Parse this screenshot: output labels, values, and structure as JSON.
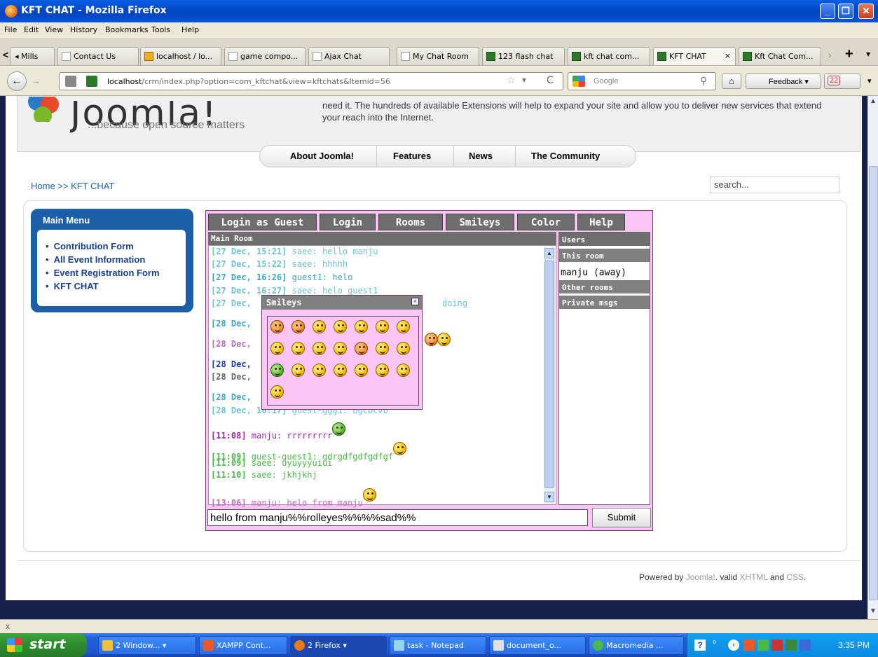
{
  "window": {
    "title": "KFT CHAT - Mozilla Firefox"
  },
  "menubar": [
    "File",
    "Edit",
    "View",
    "History",
    "Bookmarks",
    "Tools",
    "Help"
  ],
  "tabs": [
    {
      "label": "◂ Mills",
      "icon": "page-icon"
    },
    {
      "label": "Contact Us",
      "icon": "page-icon"
    },
    {
      "label": "localhost / lo...",
      "icon": "phpmyadmin-icon"
    },
    {
      "label": "game compo...",
      "icon": "page-icon"
    },
    {
      "label": "Ajax Chat",
      "icon": "page-icon"
    },
    {
      "label": "My Chat Room",
      "icon": "page-icon"
    },
    {
      "label": "123 flash chat",
      "icon": "kft-icon"
    },
    {
      "label": "kft chat com...",
      "icon": "kft-icon"
    },
    {
      "label": "KFT CHAT",
      "icon": "kft-icon"
    },
    {
      "label": "Kft Chat Com...",
      "icon": "kft-icon"
    }
  ],
  "nav": {
    "url_host": "localhost",
    "url_path": "/crm/index.php?option=com_kftchat&view=kftchats&Itemid=56",
    "search_placeholder": "Google",
    "feedback": "Feedback",
    "badge": "22"
  },
  "header": {
    "logo": "Joomla!",
    "tagline": "...because open source matters",
    "text": "need it. The hundreds of available Extensions will help to expand your site and allow you to deliver new services that extend your reach into the Internet."
  },
  "topnav": [
    "About Joomla!",
    "Features",
    "News",
    "The Community"
  ],
  "breadcrumb": "Home >> KFT CHAT",
  "search": "search...",
  "mainmenu": {
    "title": "Main Menu",
    "items": [
      "Contribution Form",
      "All Event Information",
      "Event Registration Form",
      "KFT CHAT"
    ]
  },
  "chat": {
    "buttons": [
      "Login as Guest",
      "Login",
      "Rooms",
      "Smileys",
      "Color",
      "Help"
    ],
    "room_title": "Main Room",
    "messages": [
      {
        "ts": "[27 Dec, 15:21]",
        "text": " saee: hello manju",
        "color": "#6ec3d0"
      },
      {
        "ts": "[27 Dec, 15:22]",
        "text": " saee: hhhhh",
        "color": "#6ec3d0"
      },
      {
        "ts": "[27 Dec, 16:26]",
        "text": " guest1: helo",
        "color": "#3aa6c4"
      },
      {
        "ts": "[27 Dec, 16:27]",
        "text": " saee: helo guest1",
        "color": "#6ec3d0"
      },
      {
        "ts": "[27 Dec,",
        "text": " doing",
        "color": "#6ec3d0"
      },
      {
        "ts": "[28 Dec,",
        "text": "",
        "color": "#3aa6c4"
      },
      {
        "ts": "[28 Dec,",
        "text": "",
        "color": "#c06ac0"
      },
      {
        "ts": "[28 Dec,",
        "text": "",
        "color": "#1a3aa8"
      },
      {
        "ts": "[28 Dec,",
        "text": "",
        "color": "#666666"
      },
      {
        "ts": "[28 Dec,",
        "text": "",
        "color": "#3aa6c4"
      },
      {
        "ts": "[28 Dec, 16:17]",
        "text": " guest-ggg1: bgcbcvb",
        "color": "#6ec3d0"
      },
      {
        "ts": "[11:08]",
        "text": " manju: rrrrrrrrr",
        "color": "#9a2aa8"
      },
      {
        "ts": "[11:09]",
        "text": " guest-guest1: gdrgdfgdfgdfgf",
        "color": "#4ab84a"
      },
      {
        "ts": "[11:09]",
        "text": " saee: uyuyyyuiui",
        "color": "#4ab84a"
      },
      {
        "ts": "[11:10]",
        "text": " saee: jkhjkhj",
        "color": "#4ab84a"
      },
      {
        "ts": "[13:06]",
        "text": " manju: helo from manju",
        "color": "#c06ac0"
      }
    ],
    "users_title": "Users",
    "this_room": "This room",
    "user": "manju (away)",
    "other_rooms": "Other rooms",
    "private_msgs": "Private msgs",
    "input_value": "hello from manju%%rolleyes%%%%sad%%",
    "submit": "Submit",
    "smileys_title": "Smileys"
  },
  "footer": {
    "pre": "Powered by ",
    "joomla": "Joomla!",
    "mid": ". valid ",
    "xhtml": "XHTML",
    "and": " and ",
    "css": "CSS",
    "end": "."
  },
  "status": "x",
  "taskbar": {
    "start": "start",
    "buttons": [
      "2 Window...",
      "XAMPP Cont...",
      "2 Firefox",
      "task - Notepad",
      "document_o...",
      "Macromedia ..."
    ],
    "clock": "3:35 PM"
  }
}
